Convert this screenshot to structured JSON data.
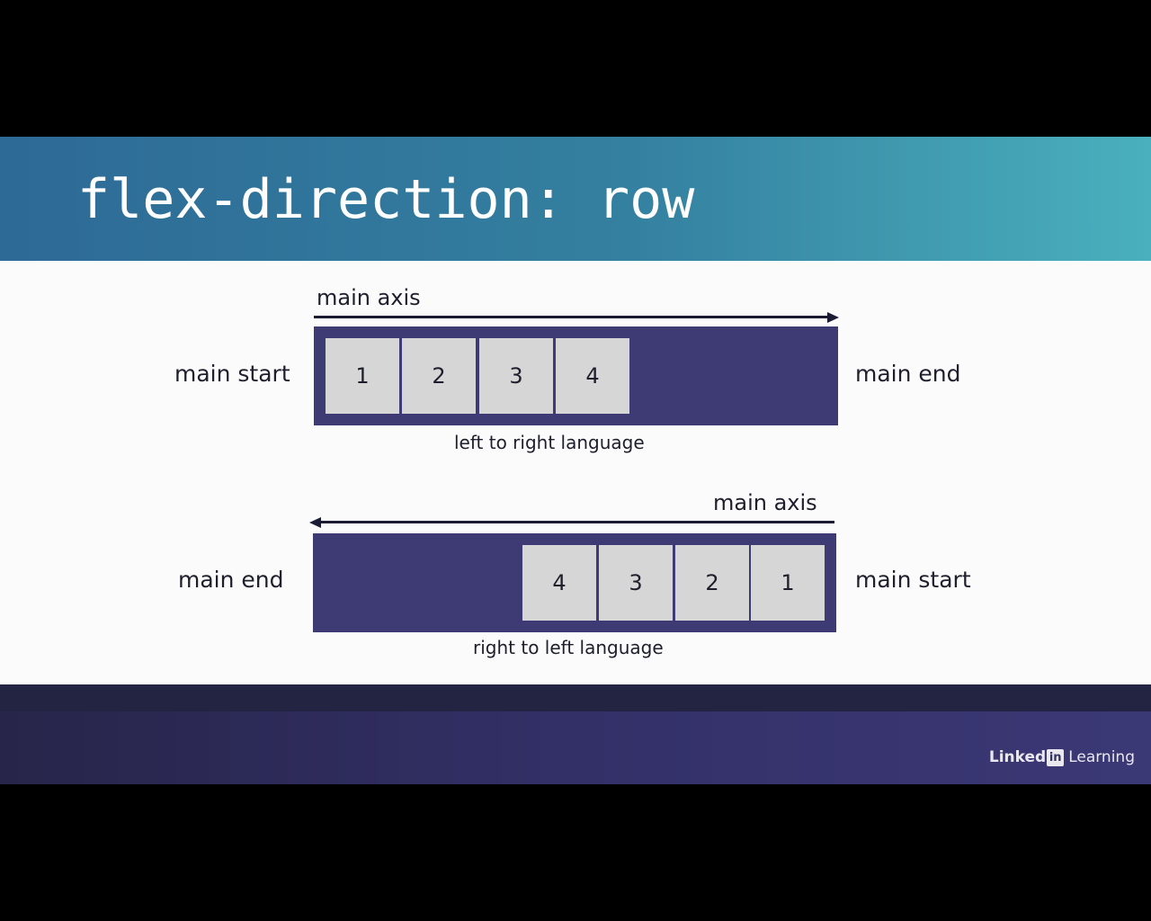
{
  "title": "flex-direction: row",
  "brand": {
    "name_bold": "Linked",
    "name_box": "in",
    "name_light": "Learning"
  },
  "diagrams": {
    "ltr": {
      "axis_label": "main axis",
      "start_label": "main start",
      "end_label": "main end",
      "caption": "left to right language",
      "items": [
        "1",
        "2",
        "3",
        "4"
      ]
    },
    "rtl": {
      "axis_label": "main axis",
      "start_label": "main start",
      "end_label": "main end",
      "caption": "right to left language",
      "items": [
        "4",
        "3",
        "2",
        "1"
      ]
    }
  },
  "colors": {
    "title_gradient_start": "#2d6a96",
    "title_gradient_end": "#4ab0bd",
    "container": "#3d3a74",
    "item": "#d6d6d6",
    "footer": "#333068"
  }
}
